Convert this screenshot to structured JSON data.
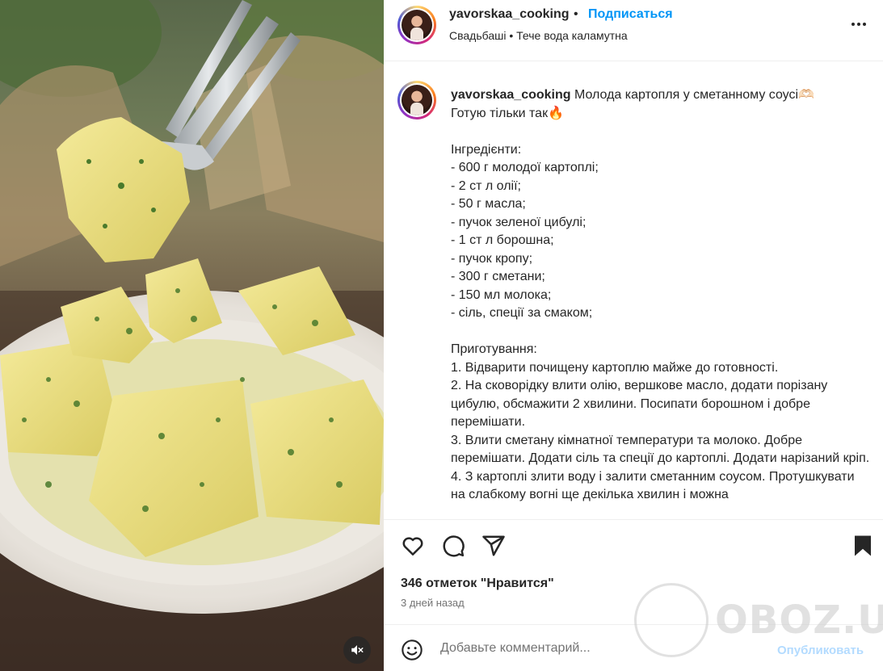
{
  "post": {
    "username": "yavorskaa_cooking",
    "dot": "•",
    "follow_label": "Подписаться",
    "audio": "Свадьбаші • Тече вода каламутна",
    "more_icon": "more-horizontal-icon"
  },
  "caption": {
    "username": "yavorskaa_cooking",
    "text": " Молода картопля у сметанному соусі🫶🏻\nГотую тільки так🔥\n\nІнгредієнти:\n- 600 г молодої картоплі;\n- 2 ст л олії;\n- 50 г масла;\n- пучок зеленої цибулі;\n- 1 ст л борошна;\n- пучок кропу;\n- 300 г сметани;\n- 150 мл молока;\n- сіль, спеції за смаком;\n\nПриготування:\n1. Відварити почищену картоплю майже до готовності.\n2. На сковорідку влити олію, вершкове масло, додати порізану цибулю, обсмажити 2 хвилини. Посипати борошном і добре перемішати.\n3. Влити сметану кімнатної температури та молоко. Добре перемішати. Додати сіль та спеції до картоплі. Додати нарізаний кріп.\n4. З картоплі злити воду і залити сметанним соусом. Протушкувати на слабкому вогні ще декілька хвилин і можна"
  },
  "actions": {
    "like_icon": "heart-icon",
    "comment_icon": "comment-icon",
    "share_icon": "share-icon",
    "save_icon": "bookmark-icon"
  },
  "likes": "346 отметок \"Нравится\"",
  "timestamp": "3 дней назад",
  "comment": {
    "placeholder": "Добавьте комментарий...",
    "post_label": "Опубликовать",
    "emoji_icon": "emoji-icon"
  },
  "watermark": "OBOZ.UA",
  "media": {
    "mute_icon": "speaker-muted-icon"
  },
  "colors": {
    "link": "#0095f6",
    "text": "#262626",
    "muted": "#737373",
    "post_disabled": "#b3dbff"
  }
}
